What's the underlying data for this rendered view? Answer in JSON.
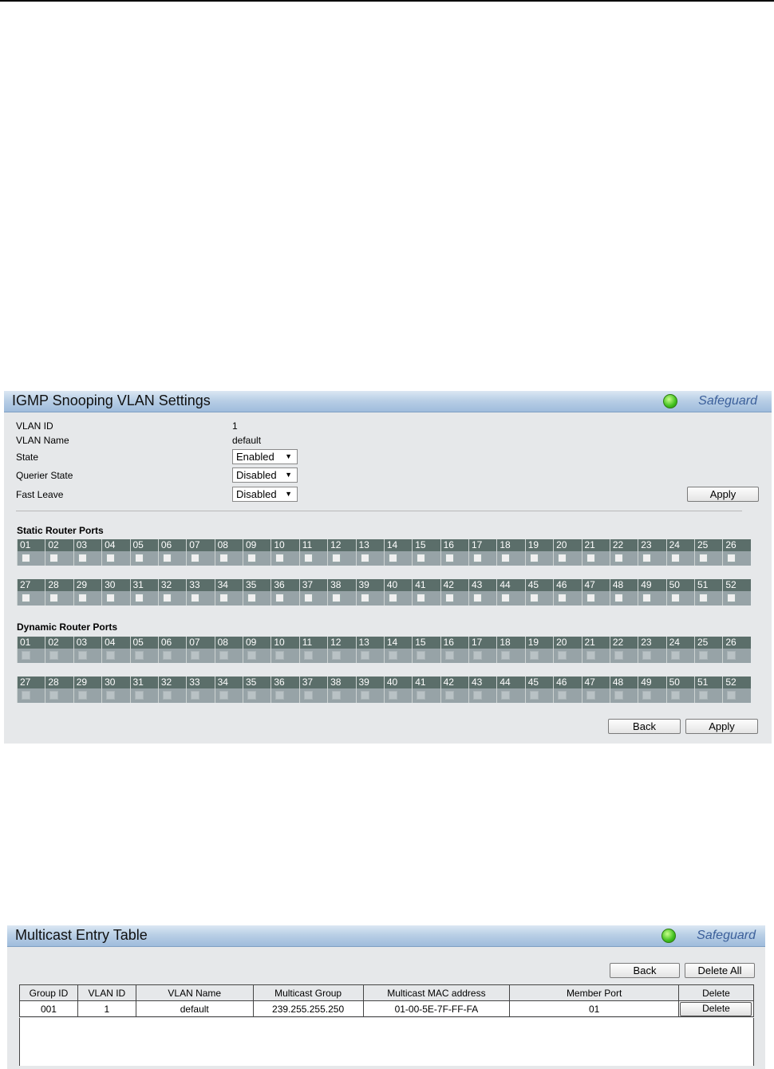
{
  "vlan_panel": {
    "title": "IGMP Snooping VLAN Settings",
    "safeguard": "Safeguard",
    "fields": {
      "vlan_id_label": "VLAN ID",
      "vlan_id_value": "1",
      "vlan_name_label": "VLAN Name",
      "vlan_name_value": "default",
      "state_label": "State",
      "state_value": "Enabled",
      "querier_label": "Querier State",
      "querier_value": "Disabled",
      "fast_leave_label": "Fast Leave",
      "fast_leave_value": "Disabled"
    },
    "apply_top": "Apply",
    "static_label": "Static Router Ports",
    "dynamic_label": "Dynamic Router Ports",
    "ports_row1": [
      "01",
      "02",
      "03",
      "04",
      "05",
      "06",
      "07",
      "08",
      "09",
      "10",
      "11",
      "12",
      "13",
      "14",
      "15",
      "16",
      "17",
      "18",
      "19",
      "20",
      "21",
      "22",
      "23",
      "24",
      "25",
      "26"
    ],
    "ports_row2": [
      "27",
      "28",
      "29",
      "30",
      "31",
      "32",
      "33",
      "34",
      "35",
      "36",
      "37",
      "38",
      "39",
      "40",
      "41",
      "42",
      "43",
      "44",
      "45",
      "46",
      "47",
      "48",
      "49",
      "50",
      "51",
      "52"
    ],
    "back": "Back",
    "apply_bottom": "Apply"
  },
  "mc_panel": {
    "title": "Multicast Entry Table",
    "safeguard": "Safeguard",
    "back": "Back",
    "delete_all": "Delete All",
    "headers": [
      "Group ID",
      "VLAN ID",
      "VLAN Name",
      "Multicast Group",
      "Multicast MAC address",
      "Member Port",
      "Delete"
    ],
    "rows": [
      [
        "001",
        "1",
        "default",
        "239.255.255.250",
        "01-00-5E-7F-FF-FA",
        "01",
        "Delete"
      ]
    ]
  }
}
